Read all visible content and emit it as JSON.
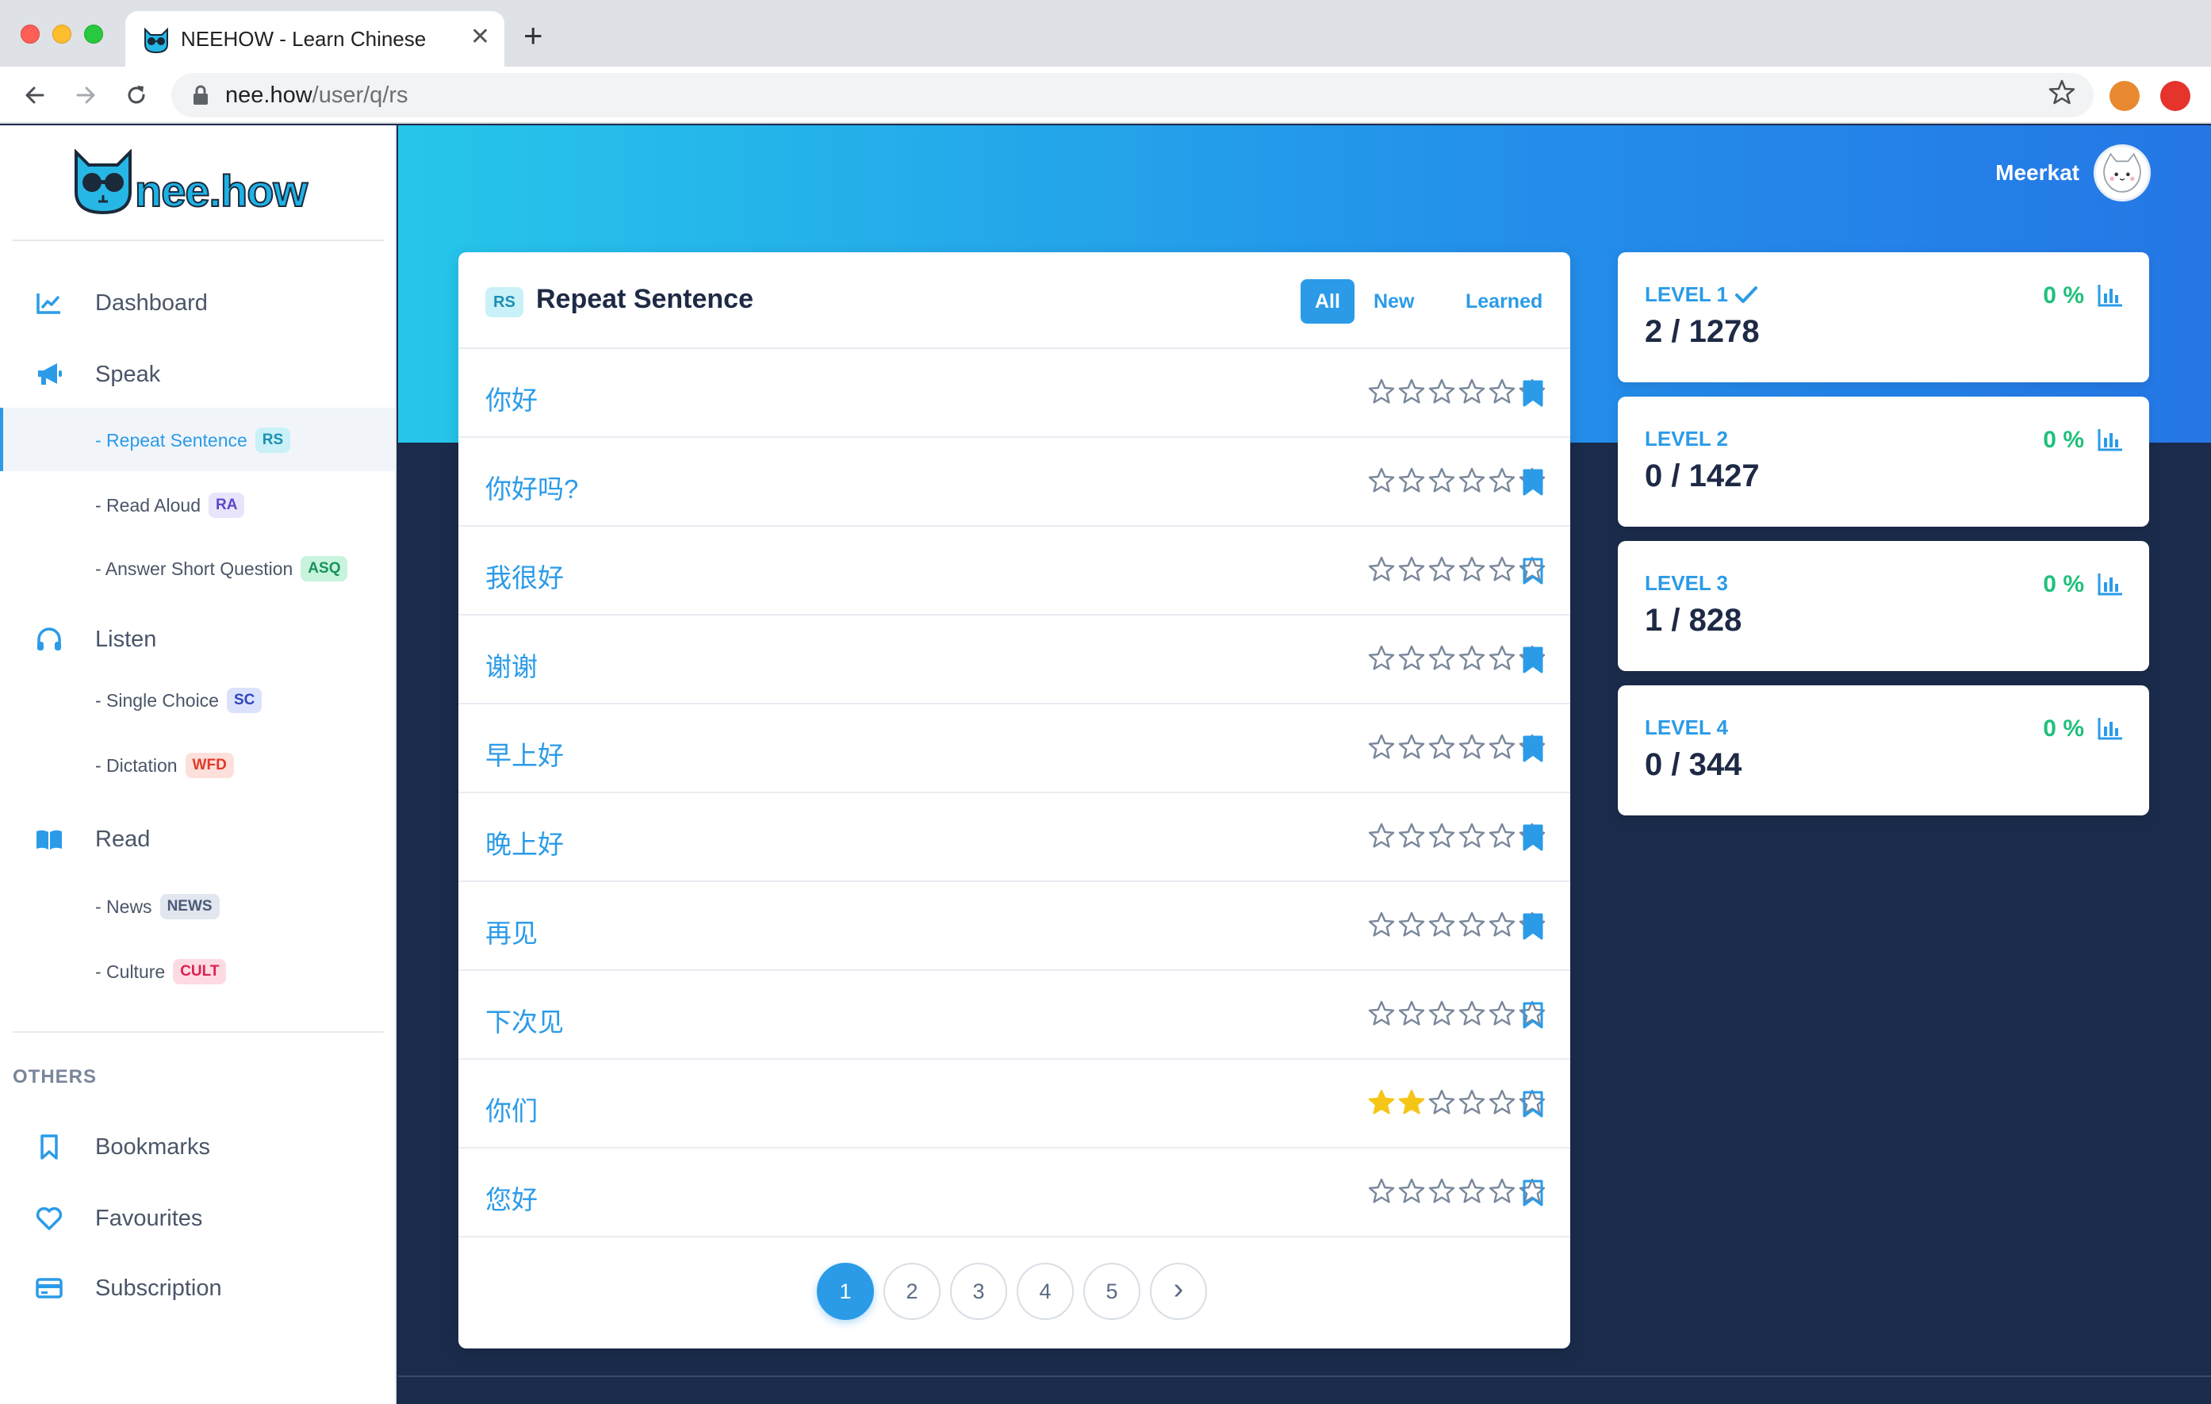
{
  "browser": {
    "tab_title": "NEEHOW - Learn Chinese",
    "tab_close": "✕",
    "new_tab": "+",
    "url_host": "nee.how",
    "url_path": "/user/q/rs"
  },
  "sidebar": {
    "logo_text": "nee.how",
    "dashboard": "Dashboard",
    "speak": "Speak",
    "speak_items": [
      {
        "label": "- Repeat Sentence",
        "badge": "RS"
      },
      {
        "label": "- Read Aloud",
        "badge": "RA"
      },
      {
        "label": "- Answer Short Question",
        "badge": "ASQ"
      }
    ],
    "listen": "Listen",
    "listen_items": [
      {
        "label": "- Single Choice",
        "badge": "SC"
      },
      {
        "label": "- Dictation",
        "badge": "WFD"
      }
    ],
    "read": "Read",
    "read_items": [
      {
        "label": "- News",
        "badge": "NEWS"
      },
      {
        "label": "- Culture",
        "badge": "CULT"
      }
    ],
    "others_label": "OTHERS",
    "bookmarks": "Bookmarks",
    "favourites": "Favourites",
    "subscription": "Subscription"
  },
  "header": {
    "user_name": "Meerkat"
  },
  "card": {
    "badge": "RS",
    "title": "Repeat Sentence",
    "filters": [
      "All",
      "New",
      "Learned"
    ],
    "rows": [
      {
        "text": "你好",
        "stars": 0,
        "bookmarked": true
      },
      {
        "text": "你好吗?",
        "stars": 0,
        "bookmarked": true
      },
      {
        "text": "我很好",
        "stars": 0,
        "bookmarked": false
      },
      {
        "text": "谢谢",
        "stars": 0,
        "bookmarked": true
      },
      {
        "text": "早上好",
        "stars": 0,
        "bookmarked": true
      },
      {
        "text": "晚上好",
        "stars": 0,
        "bookmarked": true
      },
      {
        "text": "再见",
        "stars": 0,
        "bookmarked": true
      },
      {
        "text": "下次见",
        "stars": 0,
        "bookmarked": false
      },
      {
        "text": "你们",
        "stars": 2,
        "bookmarked": false
      },
      {
        "text": "您好",
        "stars": 0,
        "bookmarked": false
      }
    ],
    "pages": [
      "1",
      "2",
      "3",
      "4",
      "5"
    ],
    "next": "›"
  },
  "levels": [
    {
      "name": "LEVEL 1",
      "count": "2 / 1278",
      "percent": "0 %",
      "completed": true
    },
    {
      "name": "LEVEL 2",
      "count": "0 / 1427",
      "percent": "0 %",
      "completed": false
    },
    {
      "name": "LEVEL 3",
      "count": "1 / 828",
      "percent": "0 %",
      "completed": false
    },
    {
      "name": "LEVEL 4",
      "count": "0 / 344",
      "percent": "0 %",
      "completed": false
    }
  ],
  "colors": {
    "accent": "#2b9be8",
    "star_filled": "#f5c518",
    "success": "#20c07a",
    "navy_bg": "#1b2b4b"
  }
}
